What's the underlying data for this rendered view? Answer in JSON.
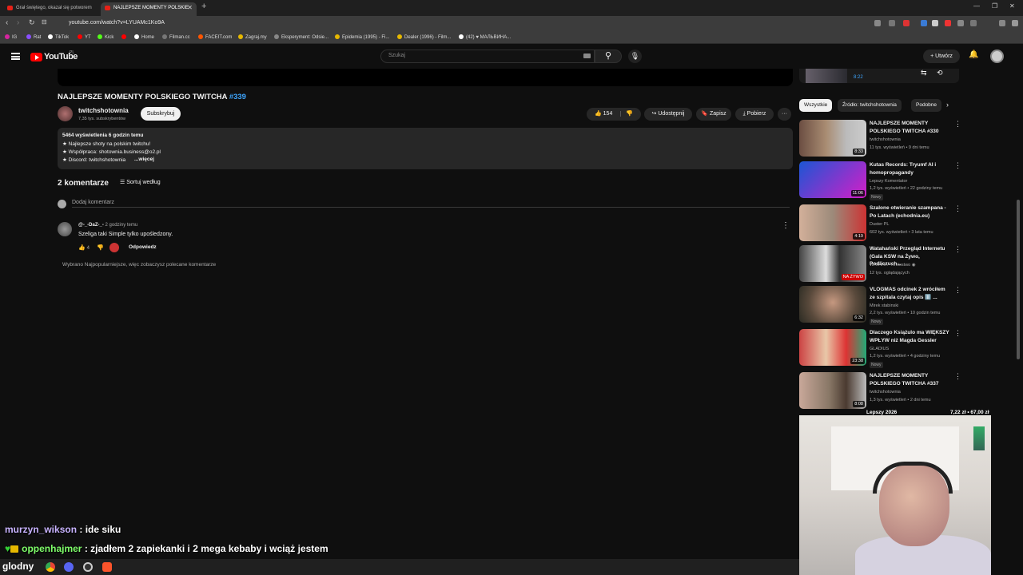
{
  "browser": {
    "tabs": [
      {
        "title": "Grał świętego, okazał się potworem"
      },
      {
        "title": "NAJLEPSZE MOMENTY POLSKIE"
      }
    ],
    "url": "youtube.com/watch?v=LYUAMc1Ko9A",
    "bookmarks": [
      "IG",
      "Rat",
      "TikTok",
      "YT",
      "Kick",
      "",
      "Home",
      "Filman.cc",
      "FACEIT.com",
      "Zagraj.my",
      "Eksperyment: Odsie...",
      "Epidemia (1995) - Fi...",
      "Dealer (1996) - Film...",
      "(42) ♥ МАЛЬВИНА..."
    ]
  },
  "youtube": {
    "logo_text": "YouTube",
    "region": "PL",
    "search_placeholder": "Szukaj",
    "create_label": "Utwórz"
  },
  "video": {
    "title": "NAJLEPSZE MOMENTY POLSKIEGO TWITCHA",
    "title_tag": "#339",
    "channel": "twitchshotownia",
    "subscribers": "7,35 tys. subskrybentów",
    "subscribe_label": "Subskrybuj",
    "likes": "154",
    "share_label": "Udostępnij",
    "save_label": "Zapisz",
    "download_label": "Pobierz",
    "description": {
      "stats": "5464 wyświetlenia  6 godzin temu",
      "line1": "★ Najlepsze shoty na polskim twitchu!",
      "line2": "★ Współpraca: shotownia.business@o2.pl",
      "line3": "★ Discord: twitchshotownia",
      "more": "...więcej"
    }
  },
  "comments": {
    "count_label": "2 komentarze",
    "sort_label": "Sortuj według",
    "add_placeholder": "Dodaj komentarz",
    "items": [
      {
        "author": "@-_-DaZ-_-",
        "time": "2 godziny temu",
        "text": "Szeliga taki Simple tylko upośledzony.",
        "likes": "4",
        "reply_label": "Odpowiedz"
      }
    ],
    "note": "Wybrano Najpopularniejsze, więc zobaczysz polecane komentarze"
  },
  "sidebar": {
    "top_duration": "8:22",
    "chips": [
      "Wszystkie",
      "Źródło: twitchshotownia",
      "Podobne"
    ],
    "recommendations": [
      {
        "title": "NAJLEPSZE MOMENTY POLSKIEGO TWITCHA #330",
        "channel": "twitchshotownia",
        "meta": "11 tys. wyświetleń • 9 dni temu",
        "duration": "8:33",
        "badge": ""
      },
      {
        "title": "Kutas Records: Tryumf AI i homopropagandy",
        "channel": "Lepszy Komentator",
        "meta": "1,2 tys. wyświetleń • 22 godziny temu",
        "duration": "11:06",
        "badge": "Nowy"
      },
      {
        "title": "Szalone otwieranie szampana - Po Latach (echodnia.eu)",
        "channel": "Duster PL",
        "meta": "602 tys. wyświetleń • 3 lata temu",
        "duration": "4:19",
        "badge": ""
      },
      {
        "title": "Watahański Przegląd Internetu (Gala KSW na Żywo, Podliczuch...",
        "channel": "WATAHA - Królestwo ◉",
        "meta": "12 tys. oglądających",
        "duration": "NA ŻYWO",
        "badge": ""
      },
      {
        "title": "VLOGMAS odcinek 2 wróciłem ze szpitala czytaj opis ℹ️ ...",
        "channel": "Mirek stabinski",
        "meta": "2,2 tys. wyświetleń • 10 godzin temu",
        "duration": "6:32",
        "badge": "Nowy"
      },
      {
        "title": "Dlaczego Książulo ma WIĘKSZY WPŁYW niż Magda Gessler",
        "channel": "GLADIUS",
        "meta": "1,2 tys. wyświetleń • 4 godziny temu",
        "duration": "23:38",
        "badge": "Nowy"
      },
      {
        "title": "NAJLEPSZE MOMENTY POLSKIEGO TWITCHA #337",
        "channel": "twitchshotownia",
        "meta": "1,3 tys. wyświetleń • 2 dni temu",
        "duration": "8:08",
        "badge": ""
      }
    ]
  },
  "overlay": {
    "donation_left": "Lepszy 2026",
    "donation_right": "7,22 zł • 67,00 zł",
    "chat": [
      {
        "user": "murzyn_wikson",
        "message": "ide siku"
      },
      {
        "user": "oppenhajmer",
        "message": "zjadłem 2 zapiekanki i 2 mega kebaby i wciąż jestem"
      }
    ],
    "taskbar_label": "glodny"
  }
}
